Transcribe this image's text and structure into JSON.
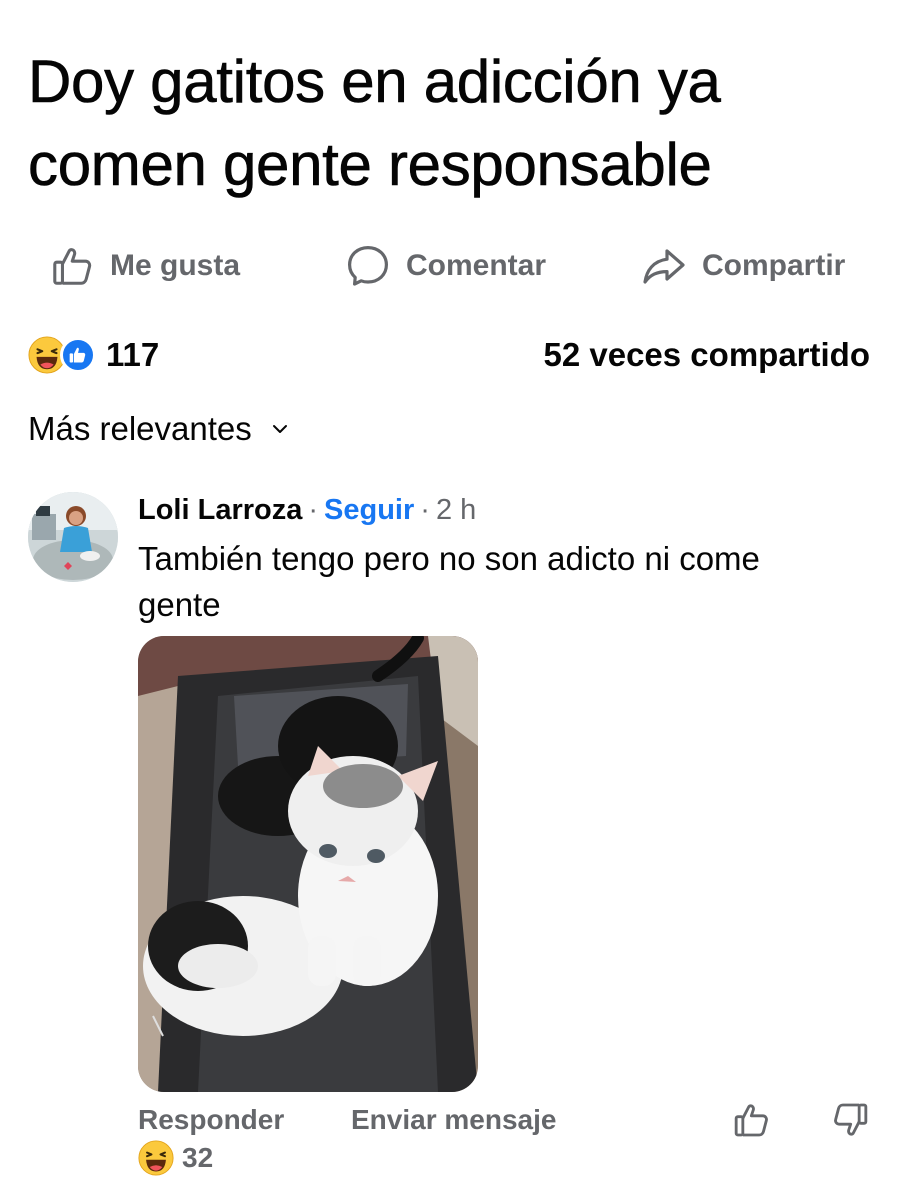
{
  "post": {
    "title": "Doy gatitos en adicción ya comen gente responsable"
  },
  "actions": {
    "like_label": "Me gusta",
    "comment_label": "Comentar",
    "share_label": "Compartir"
  },
  "stats": {
    "reaction_count": "117",
    "shares_text": "52 veces compartido",
    "reaction_icons": [
      "haha-emoji-icon",
      "like-badge-icon"
    ]
  },
  "sort": {
    "label": "Más relevantes"
  },
  "comment": {
    "author": "Loli Larroza",
    "separator": "·",
    "follow_label": "Seguir",
    "time": "2 h",
    "text": "También tengo pero no son adicto ni come gente",
    "reply_label": "Responder",
    "send_label": "Enviar mensaje",
    "reaction_count": "32"
  },
  "colors": {
    "accent": "#1877f2",
    "muted": "#65676b",
    "text": "#050505"
  }
}
